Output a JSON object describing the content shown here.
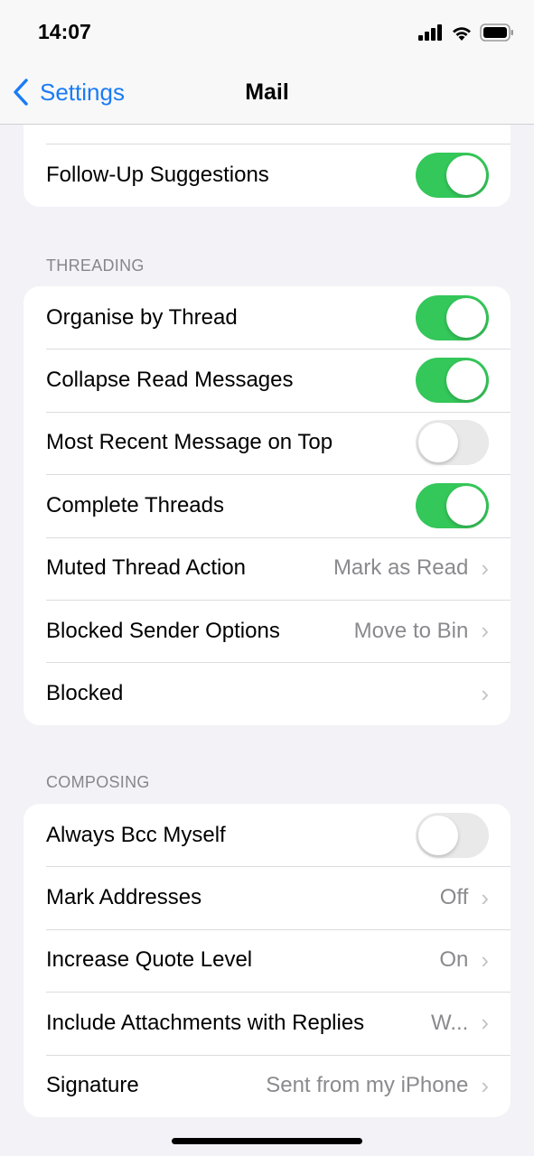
{
  "status": {
    "time": "14:07"
  },
  "nav": {
    "back": "Settings",
    "title": "Mail"
  },
  "section1": {
    "rows": [
      {
        "label": "Follow-Up Suggestions",
        "toggle": true
      }
    ]
  },
  "threading": {
    "header": "THREADING",
    "rows": [
      {
        "label": "Organise by Thread",
        "toggle": true
      },
      {
        "label": "Collapse Read Messages",
        "toggle": true
      },
      {
        "label": "Most Recent Message on Top",
        "toggle": false
      },
      {
        "label": "Complete Threads",
        "toggle": true
      },
      {
        "label": "Muted Thread Action",
        "value": "Mark as Read"
      },
      {
        "label": "Blocked Sender Options",
        "value": "Move to Bin"
      },
      {
        "label": "Blocked",
        "value": ""
      }
    ]
  },
  "composing": {
    "header": "COMPOSING",
    "rows": [
      {
        "label": "Always Bcc Myself",
        "toggle": false
      },
      {
        "label": "Mark Addresses",
        "value": "Off"
      },
      {
        "label": "Increase Quote Level",
        "value": "On"
      },
      {
        "label": "Include Attachments with Replies",
        "value": "W..."
      },
      {
        "label": "Signature",
        "value": "Sent from my iPhone"
      }
    ]
  },
  "colors": {
    "accent": "#1a7cf5",
    "toggle_on": "#34c759"
  }
}
